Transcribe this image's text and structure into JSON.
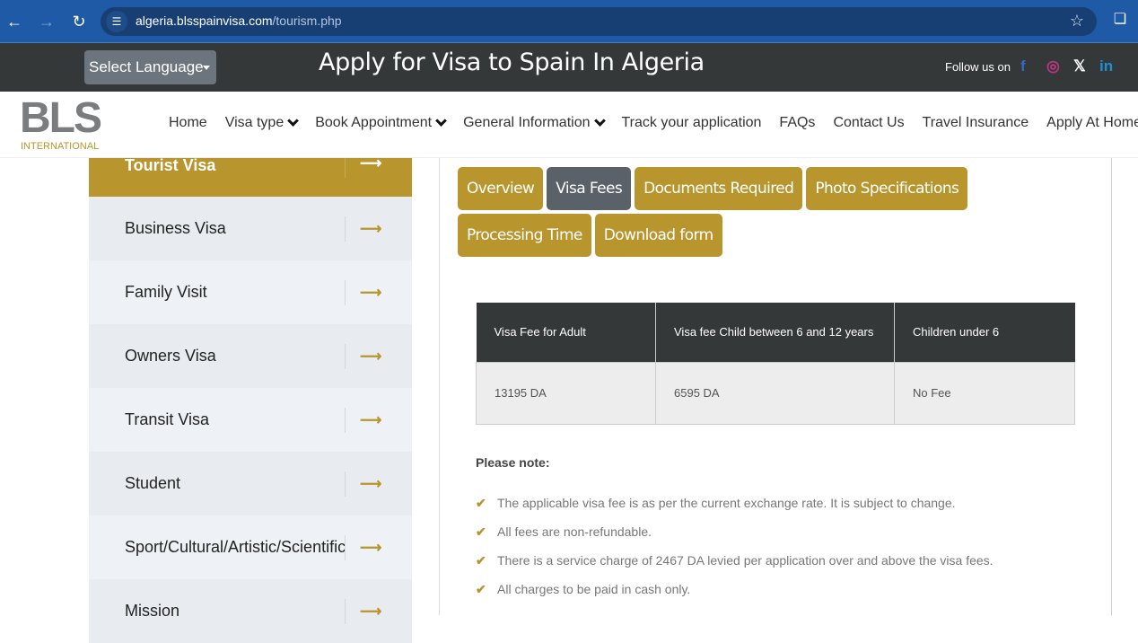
{
  "browser": {
    "url_host": "algeria.blsspainvisa.com",
    "url_path": "/tourism.php",
    "icons": [
      "back-icon",
      "forward-icon",
      "reload-icon",
      "site-info-icon",
      "star-icon",
      "extensions-icon"
    ]
  },
  "topbar": {
    "language_select": "Select Language",
    "title": "Apply for Visa to Spain In Algeria",
    "follow_label": "Follow us on",
    "social": [
      {
        "name": "facebook",
        "glyph": "f",
        "color": "#3b66c4"
      },
      {
        "name": "instagram",
        "glyph": "◎",
        "color": "#c13584"
      },
      {
        "name": "x",
        "glyph": "𝕏",
        "color": "#ffffff"
      },
      {
        "name": "linkedin",
        "glyph": "in",
        "color": "#1d8fd6"
      }
    ]
  },
  "logo": {
    "main": "BLS",
    "sub": "INTERNATIONAL"
  },
  "nav": {
    "items": [
      {
        "label": "Home",
        "dropdown": false
      },
      {
        "label": "Visa type",
        "dropdown": true
      },
      {
        "label": "Book Appointment",
        "dropdown": true
      },
      {
        "label": "General Information",
        "dropdown": true
      },
      {
        "label": "Track your application",
        "dropdown": false
      },
      {
        "label": "FAQs",
        "dropdown": false
      },
      {
        "label": "Contact Us",
        "dropdown": false
      },
      {
        "label": "Travel Insurance",
        "dropdown": false
      },
      {
        "label": "Apply At Home",
        "dropdown": false
      }
    ]
  },
  "sidebar": {
    "arrow": "⟶",
    "items": [
      {
        "label": "Tourist Visa",
        "active": true
      },
      {
        "label": "Business Visa",
        "active": false
      },
      {
        "label": "Family Visit",
        "active": false
      },
      {
        "label": "Owners Visa",
        "active": false
      },
      {
        "label": "Transit Visa",
        "active": false
      },
      {
        "label": "Student",
        "active": false
      },
      {
        "label": "Sport/Cultural/Artistic/Scientific",
        "active": false
      },
      {
        "label": "Mission",
        "active": false
      }
    ]
  },
  "tabs": [
    {
      "label": "Overview",
      "active": false
    },
    {
      "label": "Visa Fees",
      "active": true
    },
    {
      "label": "Documents Required",
      "active": false
    },
    {
      "label": "Photo Specifications",
      "active": false
    },
    {
      "label": "Processing Time",
      "active": false
    },
    {
      "label": "Download form",
      "active": false
    }
  ],
  "fee_table": {
    "headers": [
      "Visa Fee for Adult",
      "Visa fee Child between 6 and 12 years",
      "Children under 6"
    ],
    "row": [
      "13195 DA",
      "6595 DA",
      "No Fee"
    ]
  },
  "notes": {
    "title": "Please note:",
    "items": [
      "The applicable visa fee is as per the current exchange rate. It is subject to change.",
      "All fees are non-refundable.",
      "There is a service charge of 2467 DA levied per application over and above the visa fees.",
      "All charges to be paid in cash only."
    ]
  },
  "colors": {
    "brand_gold": "#b8952d",
    "dark": "#353839",
    "active_tab": "#5a6169",
    "browser_blue": "#1f5aa6"
  }
}
